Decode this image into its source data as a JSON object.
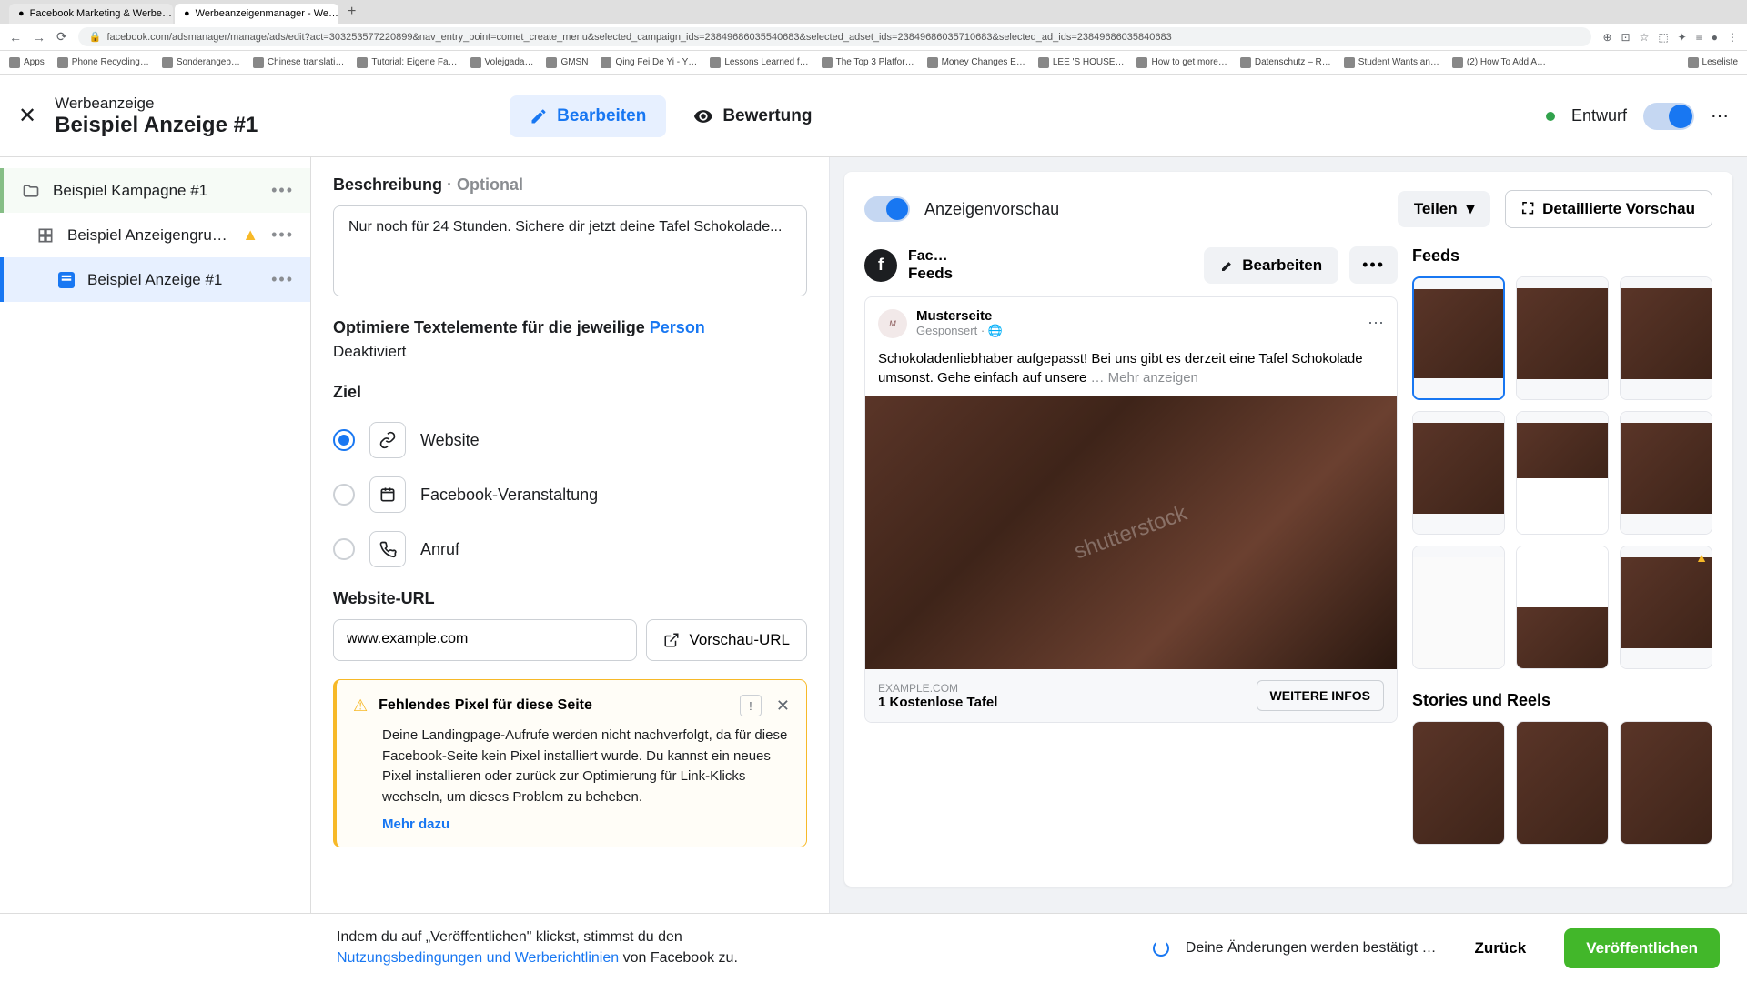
{
  "browser": {
    "tabs": [
      {
        "title": "Facebook Marketing & Werbe…",
        "active": false
      },
      {
        "title": "Werbeanzeigenmanager - We…",
        "active": true
      }
    ],
    "url": "facebook.com/adsmanager/manage/ads/edit?act=303253577220899&nav_entry_point=comet_create_menu&selected_campaign_ids=23849686035540683&selected_adset_ids=23849686035710683&selected_ad_ids=23849686035840683",
    "bookmarks": [
      "Apps",
      "Phone Recycling…",
      "Sonderangeb…",
      "Chinese translati…",
      "Tutorial: Eigene Fa…",
      "Volejgada…",
      "GMSN",
      "Qing Fei De Yi - Y…",
      "Lessons Learned f…",
      "The Top 3 Platfor…",
      "Money Changes E…",
      "LEE 'S HOUSE…",
      "How to get more…",
      "Datenschutz – R…",
      "Student Wants an…",
      "(2) How To Add A…",
      "Leseliste"
    ]
  },
  "header": {
    "supertitle": "Werbeanzeige",
    "title": "Beispiel Anzeige #1",
    "edit": "Bearbeiten",
    "review": "Bewertung",
    "status": "Entwurf"
  },
  "sidebar": {
    "campaign": "Beispiel Kampagne #1",
    "adset": "Beispiel Anzeigengrup…",
    "ad": "Beispiel Anzeige #1"
  },
  "form": {
    "desc_label": "Beschreibung",
    "optional": " · Optional",
    "desc_value": "Nur noch für 24 Stunden. Sichere dir jetzt deine Tafel Schokolade...",
    "optimize_label": "Optimiere Textelemente für die jeweilige ",
    "optimize_link": "Person",
    "optimize_status": "Deaktiviert",
    "ziel": "Ziel",
    "opt_website": "Website",
    "opt_event": "Facebook-Veranstaltung",
    "opt_call": "Anruf",
    "url_label": "Website-URL",
    "url_value": "www.example.com",
    "url_preview": "Vorschau-URL",
    "warn_title": "Fehlendes Pixel für diese Seite",
    "warn_text": "Deine Landingpage-Aufrufe werden nicht nachverfolgt, da für diese Facebook-Seite kein Pixel installiert wurde. Du kannst ein neues Pixel installieren oder zurück zur Optimierung für Link-Klicks wechseln, um dieses Problem zu beheben.",
    "warn_link": "Mehr dazu"
  },
  "preview": {
    "title": "Anzeigenvorschau",
    "share": "Teilen",
    "detail": "Detaillierte Vorschau",
    "placement_short": "Face…",
    "placement_sub": "Feeds",
    "edit": "Bearbeiten",
    "ad": {
      "page": "Musterseite",
      "sponsored": "Gesponsert · ",
      "text": "Schokoladenliebhaber aufgepasst! Bei uns gibt es derzeit eine Tafel Schokolade umsonst. Gehe einfach auf unsere",
      "more": "… Mehr anzeigen",
      "domain": "EXAMPLE.COM",
      "headline": "1 Kostenlose Tafel",
      "cta": "WEITERE INFOS"
    },
    "feeds_title": "Feeds",
    "stories_title": "Stories und Reels"
  },
  "footer": {
    "terms_pre": "Indem du auf „Veröffentlichen\" klickst, stimmst du den ",
    "terms_link": "Nutzungsbedingungen und Werberichtlinien",
    "terms_post": " von Facebook zu.",
    "pending": "Deine Änderungen werden bestätigt …",
    "back": "Zurück",
    "publish": "Veröffentlichen"
  }
}
